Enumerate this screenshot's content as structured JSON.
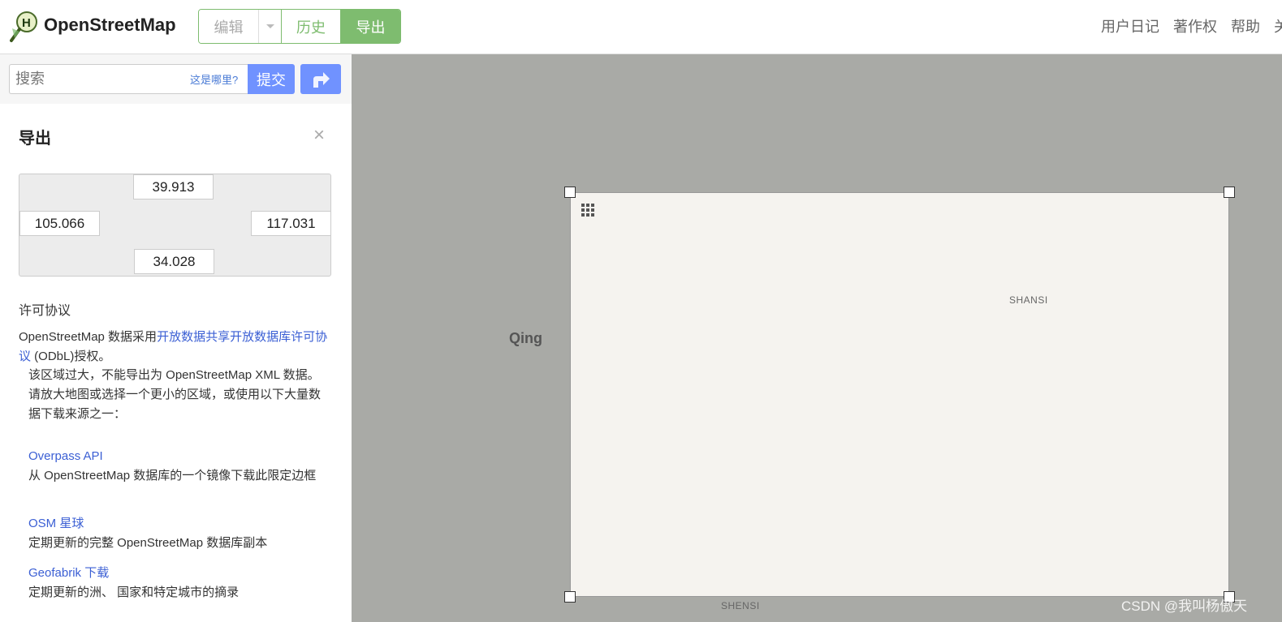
{
  "header": {
    "brand": "OpenStreetMap",
    "nav": {
      "edit": "编辑",
      "history": "历史",
      "export": "导出"
    },
    "user_menu": [
      "用户日记",
      "著作权",
      "帮助",
      "关"
    ]
  },
  "search": {
    "placeholder": "搜索",
    "where_link": "这是哪里?",
    "submit": "提交"
  },
  "export_panel": {
    "title": "导出",
    "close": "×",
    "bbox": {
      "north": "39.913",
      "west": "105.066",
      "east": "117.031",
      "south": "34.028"
    },
    "license_heading": "许可协议",
    "license_pre": "OpenStreetMap 数据采用",
    "license_link": "开放数据共享开放数据库许可协议",
    "license_post": " (ODbL)授权。",
    "warning": "该区域过大，不能导出为 OpenStreetMap XML 数据。请放大地图或选择一个更小的区域，或使用以下大量数据下载来源之一：",
    "sources": [
      {
        "name": "Overpass API",
        "desc": "从 OpenStreetMap 数据库的一个镜像下载此限定边框"
      },
      {
        "name": "OSM 星球",
        "desc": "定期更新的完整 OpenStreetMap 数据库副本"
      },
      {
        "name": "Geofabrik 下载",
        "desc": "定期更新的洲、 国家和特定城市的摘录"
      }
    ]
  },
  "map": {
    "labels": {
      "qing": "Qing",
      "shansi_top": "SHANSI",
      "shensi": "SHENSI"
    },
    "watermark": "CSDN @我叫杨傲天"
  },
  "colors": {
    "accent_green": "#7ebc6f",
    "button_blue": "#7092ff",
    "link_blue": "#3b5fd4",
    "map_gray": "#a9aaa6",
    "selection_fill": "#f5f3ef"
  }
}
